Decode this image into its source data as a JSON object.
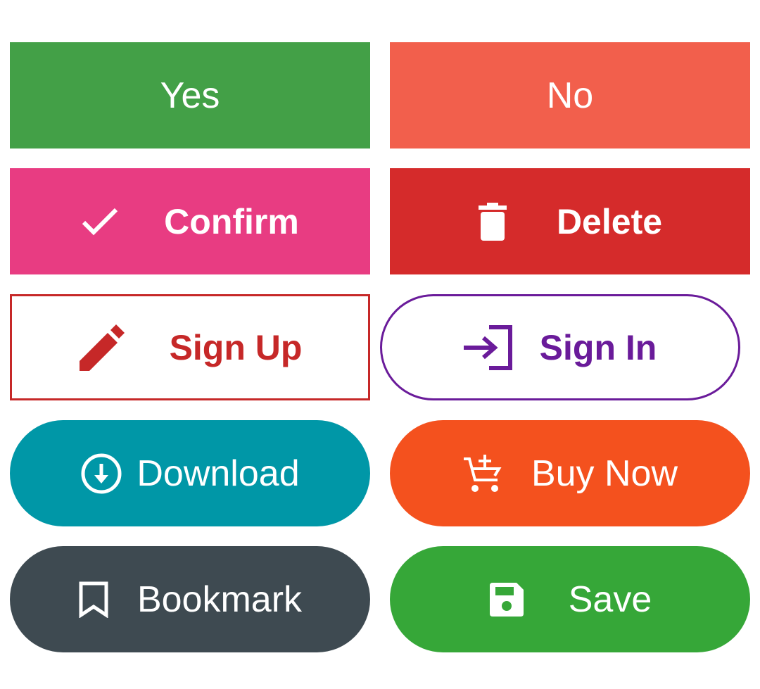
{
  "colors": {
    "yes": "#43a047",
    "no": "#f25f4c",
    "confirm": "#e83c82",
    "delete": "#d52b2b",
    "signup_border": "#c62828",
    "signin_border": "#6a1b9a",
    "download": "#0097a7",
    "buy_now": "#f4511e",
    "bookmark": "#3e4a51",
    "save": "#36a738"
  },
  "buttons": {
    "yes": {
      "label": "Yes"
    },
    "no": {
      "label": "No"
    },
    "confirm": {
      "label": "Confirm",
      "icon": "check-icon"
    },
    "delete": {
      "label": "Delete",
      "icon": "trash-icon"
    },
    "sign_up": {
      "label": "Sign Up",
      "icon": "pencil-icon"
    },
    "sign_in": {
      "label": "Sign In",
      "icon": "login-icon"
    },
    "download": {
      "label": "Download",
      "icon": "download-circle-icon"
    },
    "buy_now": {
      "label": "Buy Now",
      "icon": "add-to-cart-icon"
    },
    "bookmark": {
      "label": "Bookmark",
      "icon": "bookmark-icon"
    },
    "save": {
      "label": "Save",
      "icon": "floppy-disk-icon"
    }
  }
}
